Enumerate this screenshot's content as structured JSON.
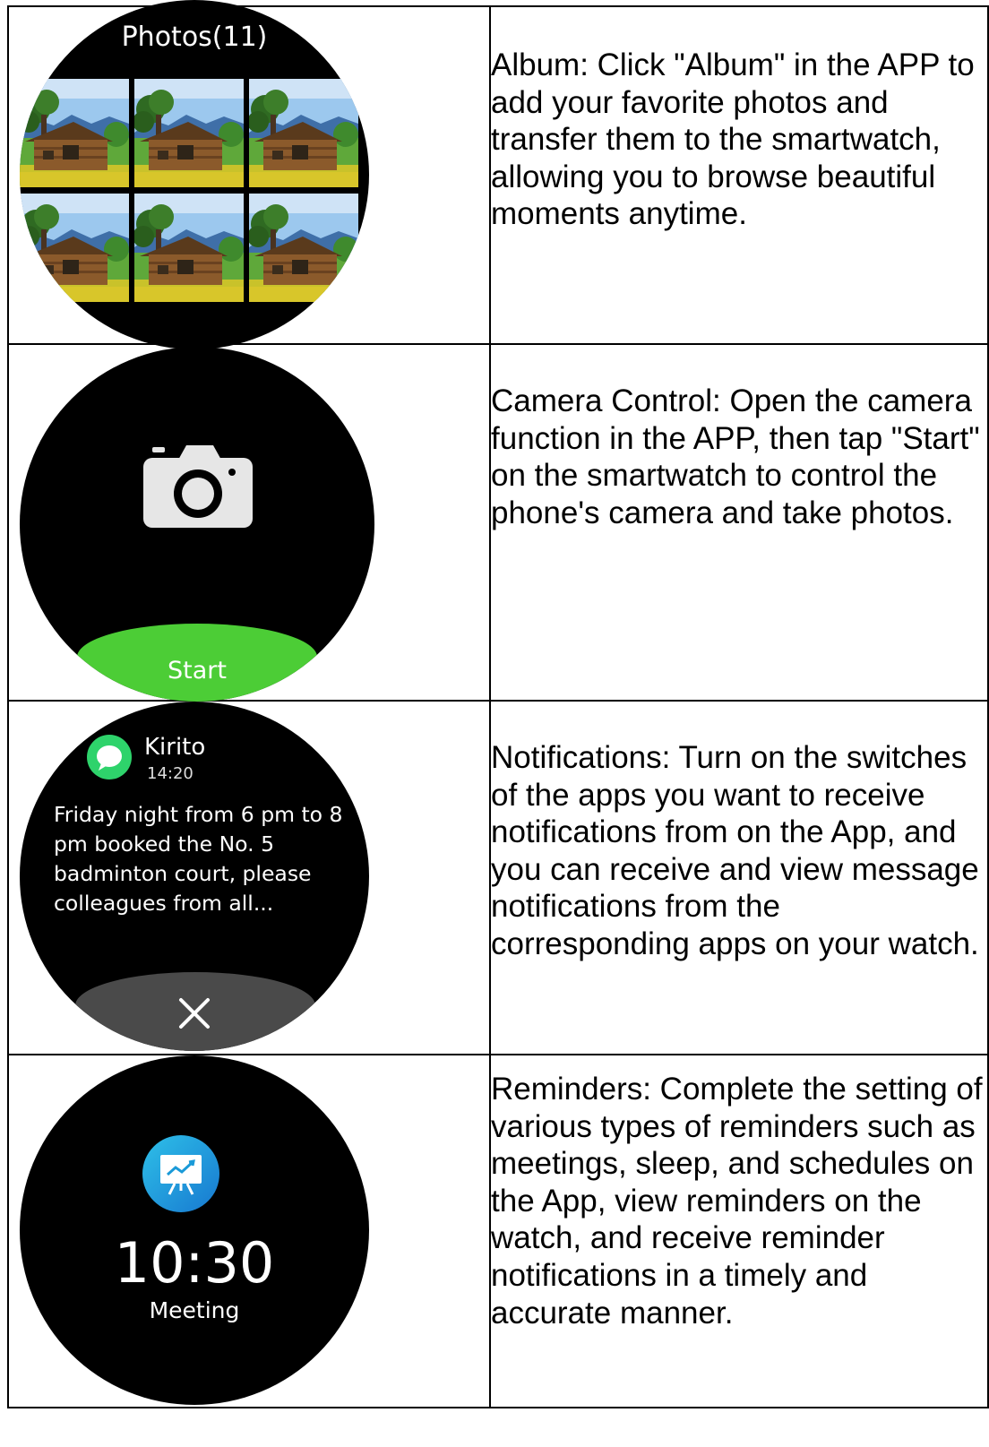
{
  "album": {
    "watch_title": "Photos(11)",
    "description": "Album: Click \"Album\" in the APP to add your favorite photos and transfer them to the smartwatch, allowing you to browse beautiful moments anytime."
  },
  "camera": {
    "start_label": "Start",
    "description": "Camera Control: Open the camera function in the APP, then tap \"Start\" on the smartwatch to control the phone's camera and take photos."
  },
  "notifications": {
    "sender": "Kirito",
    "time": "14:20",
    "message": "Friday night from 6 pm to 8 pm booked the No. 5 badminton court, please colleagues from all...",
    "description": "Notifications: Turn on the switches of the apps you want to receive notifications from on the App, and you can receive and view message notifications from the corresponding apps on your watch."
  },
  "reminders": {
    "time": "10:30",
    "label": "Meeting",
    "description": "Reminders: Complete the setting of various types of reminders such as meetings, sleep, and schedules on the App, view reminders on the watch, and receive reminder notifications in a timely and accurate manner."
  },
  "colors": {
    "start_button": "#4ccd36",
    "message_app_icon": "#2ed36b",
    "reminder_icon": "#1aa0e0",
    "dismiss_button": "#4a4a4a"
  }
}
